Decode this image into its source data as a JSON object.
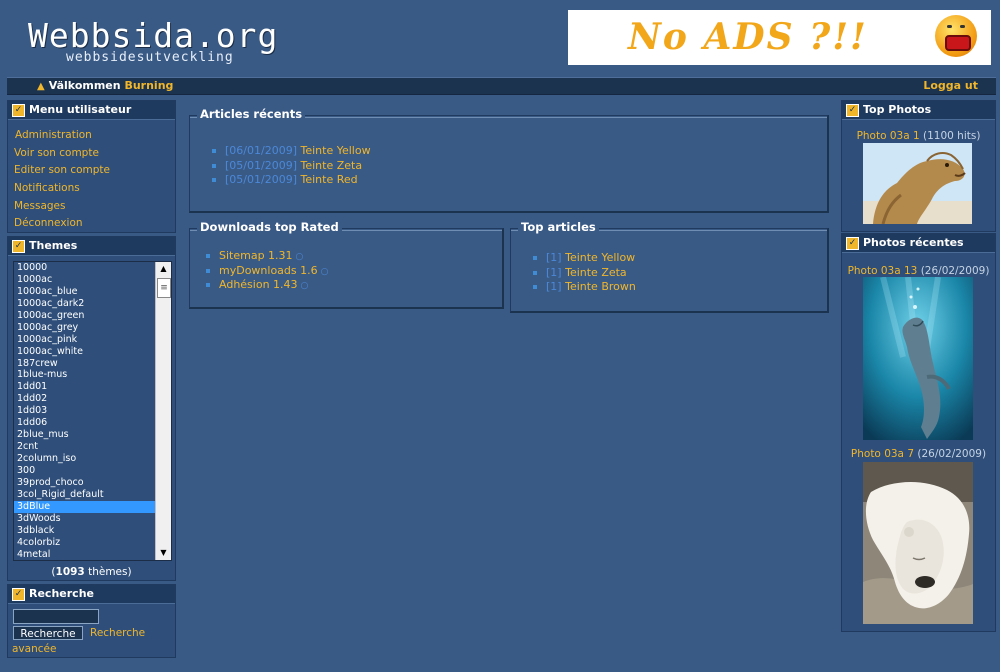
{
  "header": {
    "logo_title": "Webbsida.org",
    "logo_subtitle": "webbsidesutveckling",
    "banner_text": "No ADS ?!!"
  },
  "topbar": {
    "welcome": "Välkommen",
    "user": "Burning",
    "logout": "Logga ut"
  },
  "menu": {
    "title": "Menu utilisateur",
    "items": [
      "Administration",
      "Voir son compte",
      "Editer son compte",
      "Notifications",
      "Messages",
      "Déconnexion"
    ]
  },
  "themes": {
    "title": "Themes",
    "items": [
      "10000",
      "1000ac",
      "1000ac_blue",
      "1000ac_dark2",
      "1000ac_green",
      "1000ac_grey",
      "1000ac_pink",
      "1000ac_white",
      "187crew",
      "1blue-mus",
      "1dd01",
      "1dd02",
      "1dd03",
      "1dd06",
      "2blue_mus",
      "2cnt",
      "2column_iso",
      "300",
      "39prod_choco",
      "3col_Rigid_default",
      "3dBlue",
      "3dWoods",
      "3dblack",
      "4colorbiz",
      "4metal"
    ],
    "selected": "3dBlue",
    "count": "1093",
    "count_label": "thèmes"
  },
  "search": {
    "title": "Recherche",
    "button": "Recherche",
    "advanced": "Recherche avancée"
  },
  "articles_recents": {
    "title": "Articles récents",
    "items": [
      {
        "date": "[06/01/2009]",
        "title": "Teinte Yellow"
      },
      {
        "date": "[05/01/2009]",
        "title": "Teinte Zeta"
      },
      {
        "date": "[05/01/2009]",
        "title": "Teinte Red"
      }
    ]
  },
  "downloads": {
    "title": "Downloads top Rated",
    "items": [
      "Sitemap 1.31",
      "myDownloads 1.6",
      "Adhésion 1.43"
    ]
  },
  "top_articles": {
    "title": "Top articles",
    "items": [
      {
        "rank": "[1]",
        "title": "Teinte Yellow"
      },
      {
        "rank": "[1]",
        "title": "Teinte Zeta"
      },
      {
        "rank": "[1]",
        "title": "Teinte Brown"
      }
    ]
  },
  "top_photos": {
    "title": "Top Photos",
    "photo_name": "Photo 03a 1",
    "photo_meta": "(1100 hits)"
  },
  "recent_photos": {
    "title": "Photos récentes",
    "items": [
      {
        "name": "Photo 03a 13",
        "meta": "(26/02/2009)"
      },
      {
        "name": "Photo 03a 7",
        "meta": "(26/02/2009)"
      }
    ]
  },
  "colors": {
    "background": "#3a5a86",
    "link": "#f0b62b",
    "date": "#4b88d8",
    "selection": "#3398ff"
  }
}
